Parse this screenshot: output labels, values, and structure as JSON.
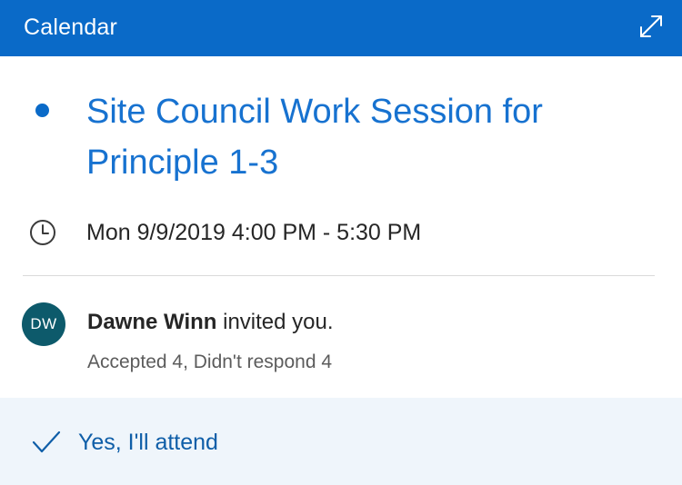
{
  "header": {
    "title": "Calendar",
    "expand_icon": "expand-diagonal-icon"
  },
  "event": {
    "title": "Site Council Work Session for Principle 1-3",
    "time": "Mon 9/9/2019 4:00 PM - 5:30 PM",
    "time_icon": "clock-icon",
    "status_icon": "calendar-color-dot"
  },
  "invite": {
    "avatar_initials": "DW",
    "organizer": "Dawne Winn",
    "action_text": " invited you.",
    "response_summary": "Accepted 4, Didn't respond 4"
  },
  "actions": {
    "attend_label": "Yes, I'll attend",
    "attend_icon": "checkmark-icon"
  },
  "colors": {
    "header_bg": "#0a6ac8",
    "accent": "#0a6ac8",
    "title_blue": "#1772d0",
    "avatar_bg": "#0d5a6b",
    "footer_bg": "#eff5fb",
    "action_blue": "#0f5ea8"
  }
}
